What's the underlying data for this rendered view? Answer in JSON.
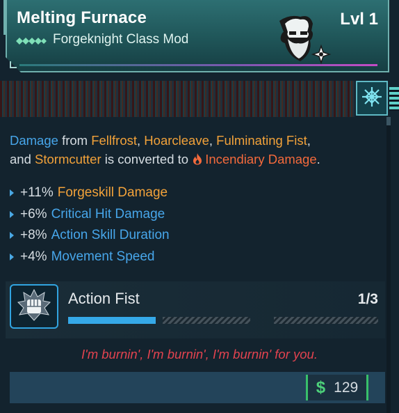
{
  "item": {
    "name": "Melting Furnace",
    "type_label": "Forgeknight Class Mod",
    "level": "Lvl 1",
    "class_icon": "forgeknight-class-icon",
    "portrait_icon": "bearded-warrior-portrait",
    "rarity_icon": "snowflake-element-icon"
  },
  "description": {
    "p1": "Damage",
    "p2": " from ",
    "p3": "Fellfrost",
    "p4": ", ",
    "p5": "Hoarcleave",
    "p6": ", ",
    "p7": "Fulminating Fist",
    "p8": ",",
    "p9": "and ",
    "p10": "Stormcutter",
    "p11": " is converted to ",
    "p12": "Incendiary Damage",
    "p13": "."
  },
  "stats": [
    {
      "value": "+11%",
      "label": "Forgeskill Damage",
      "color": "#f2a23a"
    },
    {
      "value": "+6%",
      "label": "Critical Hit Damage",
      "color": "#47a6ea"
    },
    {
      "value": "+8%",
      "label": "Action Skill Duration",
      "color": "#47a6ea"
    },
    {
      "value": "+4%",
      "label": "Movement Speed",
      "color": "#47a6ea"
    }
  ],
  "skill": {
    "name": "Action Fist",
    "rank": "1/3",
    "points": 1,
    "max_points": 3,
    "icon": "raised-fist-icon"
  },
  "flavor": "I'm burnin', I'm burnin', I'm burnin' for you.",
  "price": {
    "symbol": "$",
    "value": "129"
  },
  "colors": {
    "accent_blue": "#47a6ea",
    "accent_orange": "#f2a23a",
    "incendiary": "#f46a3c",
    "flavor": "#e2434f",
    "currency": "#4dd17a"
  }
}
